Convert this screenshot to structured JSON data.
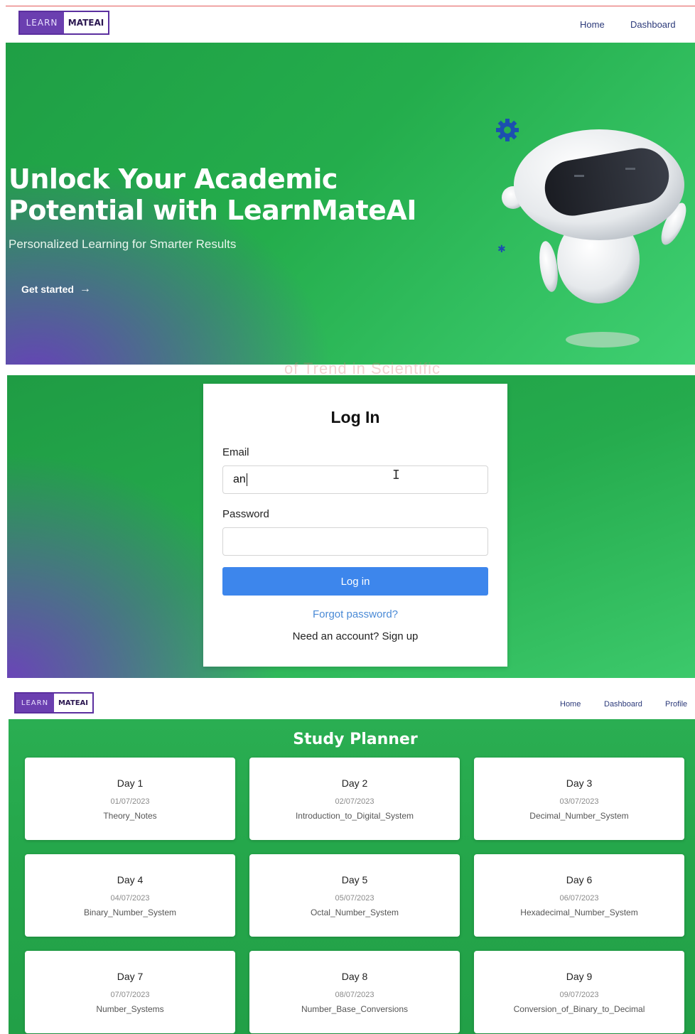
{
  "landing": {
    "logo": {
      "left": "LEARN",
      "right": "MATEAI"
    },
    "nav": {
      "home": "Home",
      "dashboard": "Dashboard"
    },
    "hero": {
      "title_line1": "Unlock Your Academic",
      "title_line2": "Potential with LearnMateAI",
      "subtitle": "Personalized Learning for Smarter Results",
      "cta": "Get started",
      "cta_icon": "arrow-right-icon"
    },
    "illustration": "robot-icon"
  },
  "watermark": "of Trend in Scientific",
  "login": {
    "title": "Log In",
    "email_label": "Email",
    "email_value": "an",
    "password_label": "Password",
    "password_value": "",
    "submit": "Log in",
    "forgot": "Forgot password?",
    "signup": "Need an account? Sign up"
  },
  "planner": {
    "logo": {
      "left": "LEARN",
      "right": "MATEAI"
    },
    "nav": {
      "home": "Home",
      "dashboard": "Dashboard",
      "profile": "Profile"
    },
    "title": "Study Planner",
    "cards": [
      {
        "day": "Day 1",
        "date": "01/07/2023",
        "topic": "Theory_Notes"
      },
      {
        "day": "Day 2",
        "date": "02/07/2023",
        "topic": "Introduction_to_Digital_System"
      },
      {
        "day": "Day 3",
        "date": "03/07/2023",
        "topic": "Decimal_Number_System"
      },
      {
        "day": "Day 4",
        "date": "04/07/2023",
        "topic": "Binary_Number_System"
      },
      {
        "day": "Day 5",
        "date": "05/07/2023",
        "topic": "Octal_Number_System"
      },
      {
        "day": "Day 6",
        "date": "06/07/2023",
        "topic": "Hexadecimal_Number_System"
      },
      {
        "day": "Day 7",
        "date": "07/07/2023",
        "topic": "Number_Systems"
      },
      {
        "day": "Day 8",
        "date": "08/07/2023",
        "topic": "Number_Base_Conversions"
      },
      {
        "day": "Day 9",
        "date": "09/07/2023",
        "topic": "Conversion_of_Binary_to_Decimal"
      }
    ]
  },
  "colors": {
    "brand_purple": "#6b3fb0",
    "hero_green": "#24ad4c",
    "button_blue": "#3d86ec",
    "link_blue": "#4a8ad6"
  }
}
